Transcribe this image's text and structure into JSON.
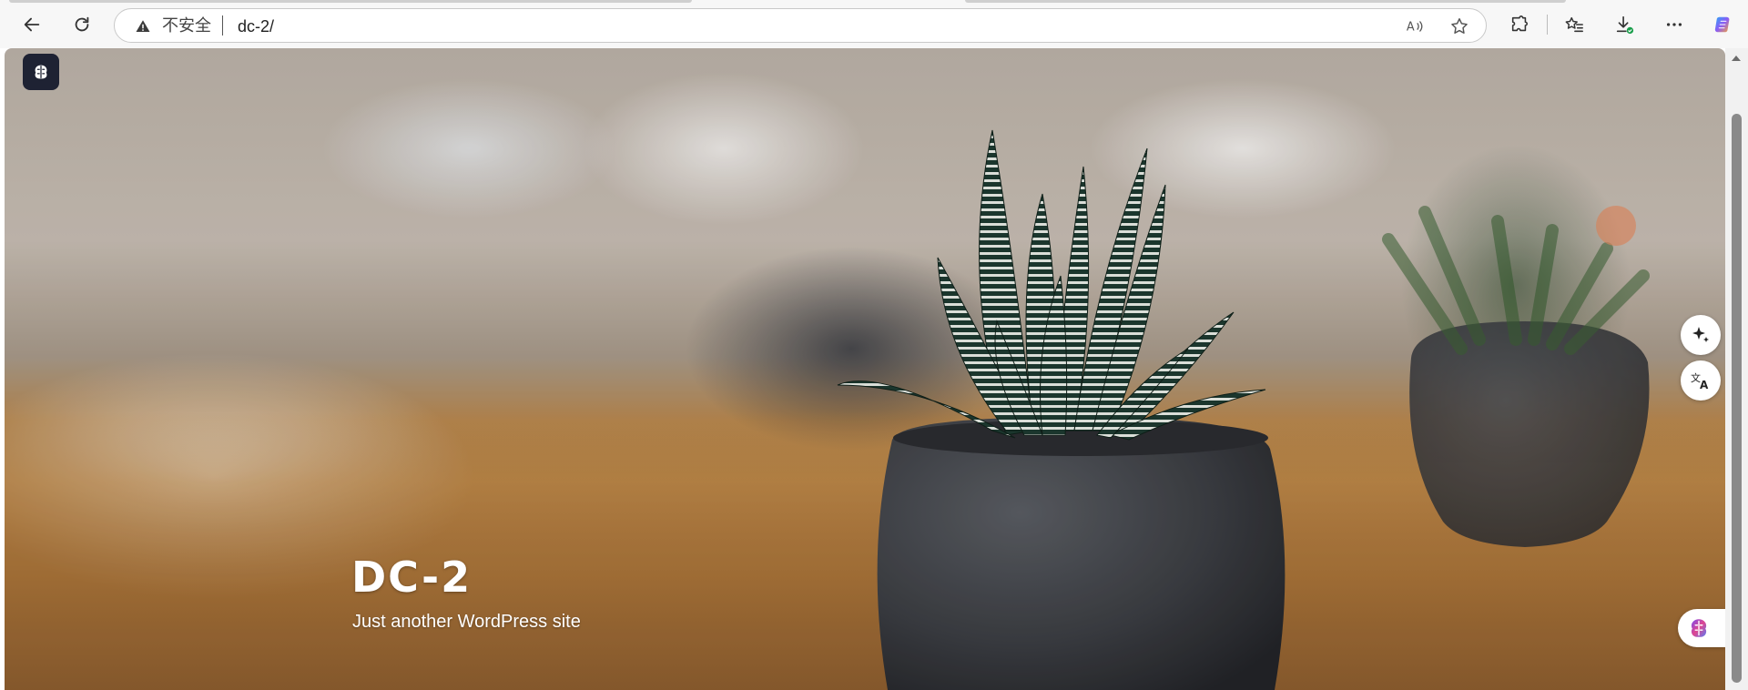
{
  "browser": {
    "address_insecure_label": "不安全",
    "url": "dc-2/",
    "icons": {
      "back": "back-arrow-icon",
      "reload": "reload-icon",
      "warning": "warning-triangle-icon",
      "read_aloud": "read-aloud-icon",
      "favorite": "star-icon",
      "extensions": "puzzle-icon",
      "favorites": "favorites-list-icon",
      "downloads": "download-icon",
      "menu": "more-dots-icon",
      "copilot": "copilot-icon"
    }
  },
  "page": {
    "site_title": "DC-2",
    "site_tagline": "Just another WordPress site"
  },
  "colors": {
    "title_text": "#ffffff",
    "logo_button_bg": "#1e2233",
    "toolbar_bg": "#f7f7f7"
  }
}
